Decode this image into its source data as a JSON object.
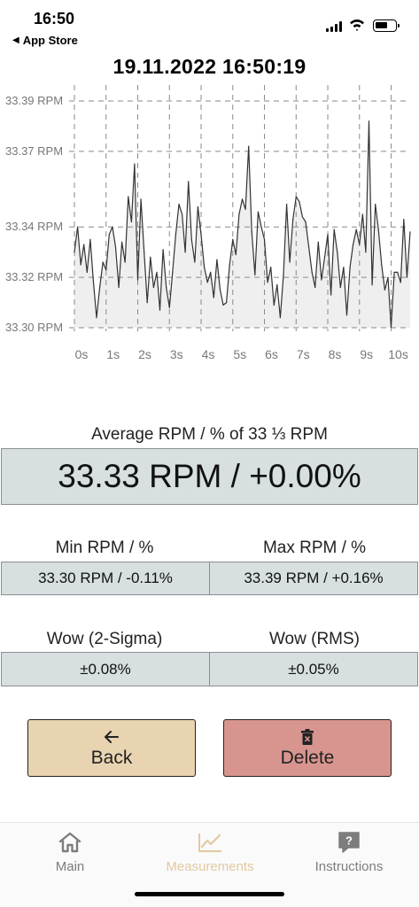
{
  "status_bar": {
    "time": "16:50",
    "back_app": "App Store",
    "back_icon": "left-triangle-icon",
    "icons": [
      "signal-icon",
      "wifi-icon",
      "battery-icon"
    ]
  },
  "header": {
    "timestamp": "19.11.2022 16:50:19"
  },
  "chart_data": {
    "type": "area",
    "title": "",
    "xlabel": "",
    "ylabel": "",
    "y_unit": "RPM",
    "ylim": [
      33.3,
      33.39
    ],
    "y_ticks": [
      33.39,
      33.37,
      33.34,
      33.32,
      33.3
    ],
    "y_tick_labels": [
      "33.39 RPM",
      "33.37 RPM",
      "33.34 RPM",
      "33.32 RPM",
      "33.30 RPM"
    ],
    "x_ticks": [
      0,
      1,
      2,
      3,
      4,
      5,
      6,
      7,
      8,
      9,
      10
    ],
    "x_tick_labels": [
      "0s",
      "1s",
      "2s",
      "3s",
      "4s",
      "5s",
      "6s",
      "7s",
      "8s",
      "9s",
      "10s"
    ],
    "xlim": [
      0,
      10.6
    ],
    "grid": true,
    "line_color": "#333333",
    "fill_color": "#efefef",
    "grid_color": "#8a8a8a",
    "series": [
      {
        "x": [
          0.0,
          0.1,
          0.2,
          0.3,
          0.4,
          0.5,
          0.6,
          0.7,
          0.8,
          0.9,
          1.0,
          1.1,
          1.2,
          1.3,
          1.4,
          1.5,
          1.6,
          1.7,
          1.8,
          1.9,
          2.0,
          2.1,
          2.2,
          2.3,
          2.4,
          2.5,
          2.6,
          2.7,
          2.8,
          2.9,
          3.0,
          3.1,
          3.2,
          3.3,
          3.4,
          3.5,
          3.6,
          3.7,
          3.8,
          3.9,
          4.0,
          4.1,
          4.2,
          4.3,
          4.4,
          4.5,
          4.6,
          4.7,
          4.8,
          4.9,
          5.0,
          5.1,
          5.2,
          5.3,
          5.4,
          5.5,
          5.6,
          5.7,
          5.8,
          5.9,
          6.0,
          6.1,
          6.2,
          6.3,
          6.4,
          6.5,
          6.6,
          6.7,
          6.8,
          6.9,
          7.0,
          7.1,
          7.2,
          7.3,
          7.4,
          7.5,
          7.6,
          7.7,
          7.8,
          7.9,
          8.0,
          8.1,
          8.2,
          8.3,
          8.4,
          8.5,
          8.6,
          8.7,
          8.8,
          8.9,
          9.0,
          9.1,
          9.2,
          9.3,
          9.4,
          9.5,
          9.6,
          9.7,
          9.8,
          9.9,
          10.0,
          10.1,
          10.2,
          10.3,
          10.4,
          10.5,
          10.6
        ],
        "values": [
          33.33,
          33.34,
          33.325,
          33.333,
          33.322,
          33.335,
          33.318,
          33.304,
          33.316,
          33.326,
          33.323,
          33.337,
          33.34,
          33.332,
          33.316,
          33.334,
          33.326,
          33.352,
          33.342,
          33.365,
          33.319,
          33.351,
          33.33,
          33.31,
          33.328,
          33.316,
          33.322,
          33.307,
          33.331,
          33.316,
          33.308,
          33.322,
          33.337,
          33.349,
          33.345,
          33.33,
          33.358,
          33.335,
          33.326,
          33.348,
          33.337,
          33.324,
          33.318,
          33.322,
          33.312,
          33.327,
          33.315,
          33.309,
          33.31,
          33.325,
          33.335,
          33.329,
          33.345,
          33.351,
          33.347,
          33.372,
          33.338,
          33.321,
          33.346,
          33.34,
          33.335,
          33.318,
          33.324,
          33.309,
          33.317,
          33.304,
          33.321,
          33.349,
          33.326,
          33.343,
          33.352,
          33.35,
          33.344,
          33.342,
          33.332,
          33.322,
          33.316,
          33.334,
          33.319,
          33.328,
          33.337,
          33.313,
          33.339,
          33.33,
          33.316,
          33.324,
          33.305,
          33.324,
          33.333,
          33.339,
          33.333,
          33.345,
          33.33,
          33.382,
          33.317,
          33.349,
          33.339,
          33.325,
          33.315,
          33.32,
          33.3,
          33.322,
          33.322,
          33.318,
          33.343,
          33.32,
          33.338
        ]
      }
    ]
  },
  "stats": {
    "average_label": "Average RPM / % of 33 ⅓ RPM",
    "average_value": "33.33 RPM / +0.00%",
    "min_label": "Min RPM / %",
    "min_value": "33.30 RPM / -0.11%",
    "max_label": "Max RPM / %",
    "max_value": "33.39 RPM / +0.16%",
    "wow2_label": "Wow (2-Sigma)",
    "wow2_value": "±0.08%",
    "wowrms_label": "Wow (RMS)",
    "wowrms_value": "±0.05%"
  },
  "actions": {
    "back_label": "Back",
    "back_icon": "arrow-left-icon",
    "back_color": "#e9d4b1",
    "delete_label": "Delete",
    "delete_icon": "trash-icon",
    "delete_color": "#d89590"
  },
  "tabs": [
    {
      "label": "Main",
      "icon": "home-icon",
      "active": false
    },
    {
      "label": "Measurements",
      "icon": "chart-line-icon",
      "active": true
    },
    {
      "label": "Instructions",
      "icon": "question-bubble-icon",
      "active": false
    }
  ],
  "colors": {
    "stat_box": "#d7dfe0",
    "active_tab": "#e2c9a0",
    "inactive_tab": "#7d7d7d"
  }
}
